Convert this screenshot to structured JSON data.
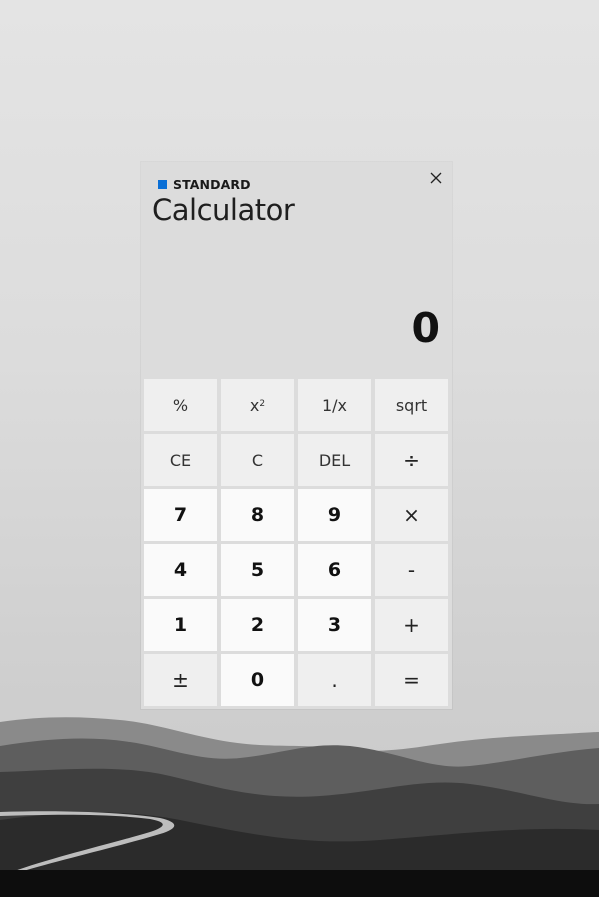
{
  "window": {
    "mode": "STANDARD",
    "title": "Calculator",
    "display_value": "0",
    "accent_color": "#0a6fd6"
  },
  "keys": [
    {
      "label": "%",
      "type": "op",
      "name": "percent-button"
    },
    {
      "label": "x",
      "sup": "2",
      "type": "op",
      "name": "square-button"
    },
    {
      "label": "1/x",
      "type": "op",
      "name": "reciprocal-button"
    },
    {
      "label": "sqrt",
      "type": "op",
      "name": "sqrt-button"
    },
    {
      "label": "CE",
      "type": "op",
      "name": "clear-entry-button"
    },
    {
      "label": "C",
      "type": "op",
      "name": "clear-button"
    },
    {
      "label": "DEL",
      "type": "op",
      "name": "delete-button"
    },
    {
      "label": "÷",
      "type": "op sym",
      "name": "divide-button"
    },
    {
      "label": "7",
      "type": "num",
      "name": "digit-7-button"
    },
    {
      "label": "8",
      "type": "num",
      "name": "digit-8-button"
    },
    {
      "label": "9",
      "type": "num",
      "name": "digit-9-button"
    },
    {
      "label": "×",
      "type": "op sym",
      "name": "multiply-button"
    },
    {
      "label": "4",
      "type": "num",
      "name": "digit-4-button"
    },
    {
      "label": "5",
      "type": "num",
      "name": "digit-5-button"
    },
    {
      "label": "6",
      "type": "num",
      "name": "digit-6-button"
    },
    {
      "label": "-",
      "type": "op sym",
      "name": "subtract-button"
    },
    {
      "label": "1",
      "type": "num",
      "name": "digit-1-button"
    },
    {
      "label": "2",
      "type": "num",
      "name": "digit-2-button"
    },
    {
      "label": "3",
      "type": "num",
      "name": "digit-3-button"
    },
    {
      "label": "+",
      "type": "op sym",
      "name": "add-button"
    },
    {
      "label": "±",
      "type": "op sym",
      "name": "negate-button"
    },
    {
      "label": "0",
      "type": "num",
      "name": "digit-0-button"
    },
    {
      "label": ".",
      "type": "op sym",
      "name": "decimal-button"
    },
    {
      "label": "=",
      "type": "op sym",
      "name": "equals-button"
    }
  ],
  "icons": {
    "close": "close-icon",
    "mode": "mode-square-icon"
  }
}
